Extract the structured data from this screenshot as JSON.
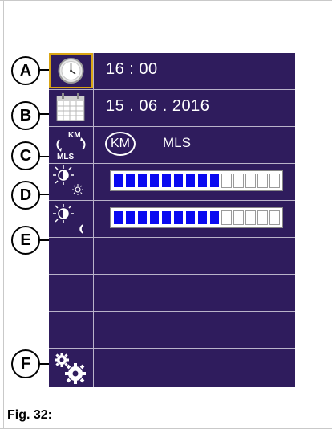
{
  "colors": {
    "screen_bg": "#2f1c5d",
    "bar_filled": "#0a0af0",
    "bar_empty": "#ffffff",
    "clock_border": "#d9a514"
  },
  "rows": [
    {
      "letter": "A",
      "icon": "clock-icon",
      "value": "16 : 00"
    },
    {
      "letter": "B",
      "icon": "calendar-icon",
      "value": "15 . 06 . 2016"
    },
    {
      "letter": "C",
      "icon": "km-mls-toggle-icon",
      "km_label": "KM",
      "mls_label": "MLS",
      "icon_text_top": "KM",
      "icon_text_bottom": "MLS"
    },
    {
      "letter": "D",
      "icon": "brightness-day-icon",
      "level_segments": 9,
      "total_segments": 14
    },
    {
      "letter": "E",
      "icon": "brightness-night-icon",
      "level_segments": 9,
      "total_segments": 14
    },
    {
      "letter": "F",
      "icon": "settings-gears-icon"
    }
  ],
  "caption": "Fig. 32:"
}
